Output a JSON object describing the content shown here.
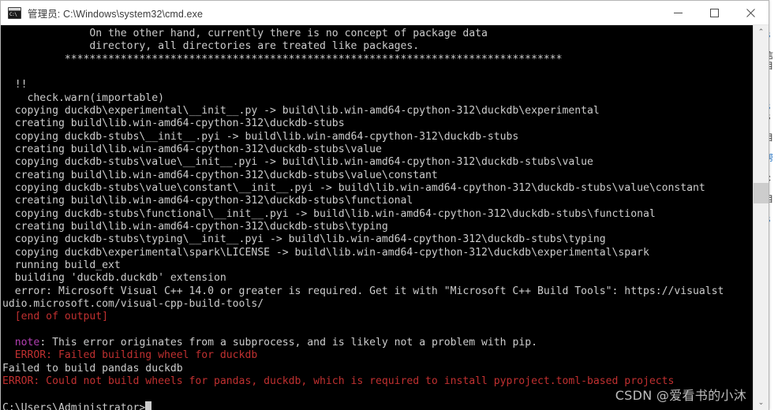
{
  "window": {
    "title": "管理员: C:\\Windows\\system32\\cmd.exe",
    "icon_label": "C:\\",
    "minimize_label": "最小化",
    "maximize_label": "最大化",
    "close_label": "关闭"
  },
  "scrollbar": {
    "up_arrow": "⌃",
    "down_arrow": "⌄"
  },
  "watermark": {
    "text": "CSDN @爱看书的小沐"
  },
  "console": {
    "prompt": "C:\\Users\\Administrator>",
    "lines": [
      {
        "text": "              On the other hand, currently there is no concept of package data",
        "color": "white"
      },
      {
        "text": "              directory, all directories are treated like packages.",
        "color": "white"
      },
      {
        "text": "          ********************************************************************************",
        "color": "white"
      },
      {
        "text": "",
        "color": "white"
      },
      {
        "text": "  !!",
        "color": "white"
      },
      {
        "text": "    check.warn(importable)",
        "color": "white"
      },
      {
        "text": "  copying duckdb\\experimental\\__init__.py -> build\\lib.win-amd64-cpython-312\\duckdb\\experimental",
        "color": "white"
      },
      {
        "text": "  creating build\\lib.win-amd64-cpython-312\\duckdb-stubs",
        "color": "white"
      },
      {
        "text": "  copying duckdb-stubs\\__init__.pyi -> build\\lib.win-amd64-cpython-312\\duckdb-stubs",
        "color": "white"
      },
      {
        "text": "  creating build\\lib.win-amd64-cpython-312\\duckdb-stubs\\value",
        "color": "white"
      },
      {
        "text": "  copying duckdb-stubs\\value\\__init__.pyi -> build\\lib.win-amd64-cpython-312\\duckdb-stubs\\value",
        "color": "white"
      },
      {
        "text": "  creating build\\lib.win-amd64-cpython-312\\duckdb-stubs\\value\\constant",
        "color": "white"
      },
      {
        "text": "  copying duckdb-stubs\\value\\constant\\__init__.pyi -> build\\lib.win-amd64-cpython-312\\duckdb-stubs\\value\\constant",
        "color": "white"
      },
      {
        "text": "  creating build\\lib.win-amd64-cpython-312\\duckdb-stubs\\functional",
        "color": "white"
      },
      {
        "text": "  copying duckdb-stubs\\functional\\__init__.pyi -> build\\lib.win-amd64-cpython-312\\duckdb-stubs\\functional",
        "color": "white"
      },
      {
        "text": "  creating build\\lib.win-amd64-cpython-312\\duckdb-stubs\\typing",
        "color": "white"
      },
      {
        "text": "  copying duckdb-stubs\\typing\\__init__.pyi -> build\\lib.win-amd64-cpython-312\\duckdb-stubs\\typing",
        "color": "white"
      },
      {
        "text": "  copying duckdb\\experimental\\spark\\LICENSE -> build\\lib.win-amd64-cpython-312\\duckdb\\experimental\\spark",
        "color": "white"
      },
      {
        "text": "  running build_ext",
        "color": "white"
      },
      {
        "text": "  building 'duckdb.duckdb' extension",
        "color": "white"
      },
      {
        "text": "  error: Microsoft Visual C++ 14.0 or greater is required. Get it with \"Microsoft C++ Build Tools\": https://visualst",
        "color": "white"
      },
      {
        "text": "udio.microsoft.com/visual-cpp-build-tools/",
        "color": "white"
      },
      {
        "text": "  [end of output]",
        "color": "red"
      },
      {
        "text": "",
        "color": "white"
      },
      {
        "text": "  note: This error originates from a subprocess, and is likely not a problem with pip.",
        "color": "note"
      },
      {
        "text": "  ERROR: Failed building wheel for duckdb",
        "color": "red"
      },
      {
        "text": "Failed to build pandas duckdb",
        "color": "white"
      },
      {
        "text": "ERROR: Could not build wheels for pandas, duckdb, which is required to install pyproject.toml-based projects",
        "color": "red"
      },
      {
        "text": "",
        "color": "white"
      }
    ],
    "note_keyword": "note",
    "note_rest": ": This error originates from a subprocess, and is likely not a problem with pip.",
    "colors": {
      "background": "#000000",
      "foreground": "#cccccc",
      "error": "#c03030",
      "note": "#b33fb3"
    }
  },
  "background_page": {
    "lines": [
      {
        "text": "信",
        "link": false
      },
      {
        "text": "目",
        "link": false
      },
      {
        "text": "S",
        "link": true
      },
      {
        "text": "e",
        "link": true
      },
      {
        "text": "S",
        "link": false
      },
      {
        "text": "目",
        "link": false
      },
      {
        "text": "S",
        "link": true
      },
      {
        "text": "帮",
        "link": true
      },
      {
        "text": "C",
        "link": false
      },
      {
        "text": "目",
        "link": false
      },
      {
        "text": "a",
        "link": true
      },
      {
        "text": "帮",
        "link": false
      },
      {
        "text": "S",
        "link": true
      }
    ]
  }
}
